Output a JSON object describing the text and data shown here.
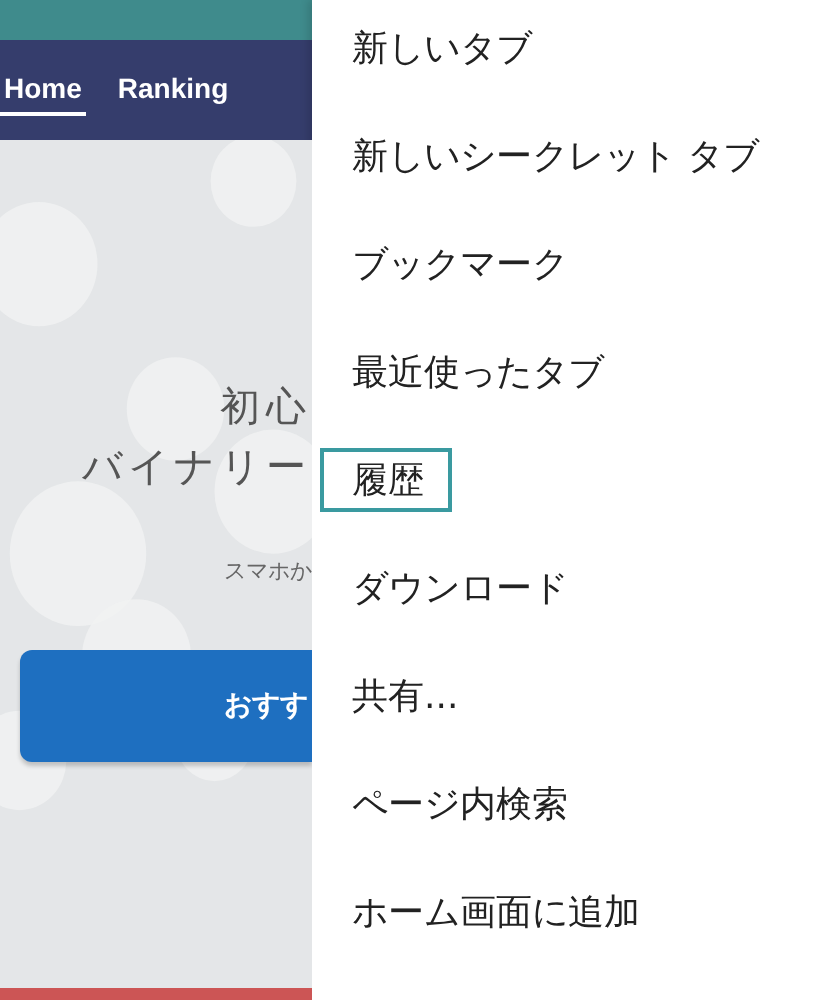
{
  "page": {
    "nav": [
      {
        "label": "Home",
        "selected": true
      },
      {
        "label": "Ranking",
        "selected": false
      }
    ],
    "hero": {
      "title_lines": [
        "初心",
        "バイナリー"
      ],
      "subtitle": "スマホか",
      "button": "おすす"
    }
  },
  "menu": {
    "items": [
      {
        "label": "新しいタブ",
        "selected": false
      },
      {
        "label": "新しいシークレット タブ",
        "selected": false
      },
      {
        "label": "ブックマーク",
        "selected": false
      },
      {
        "label": "最近使ったタブ",
        "selected": false
      },
      {
        "label": "履歴",
        "selected": true
      },
      {
        "label": "ダウンロード",
        "selected": false
      },
      {
        "label": "共有...",
        "selected": false
      },
      {
        "label": "ページ内検索",
        "selected": false
      },
      {
        "label": "ホーム画面に追加",
        "selected": false
      }
    ]
  }
}
